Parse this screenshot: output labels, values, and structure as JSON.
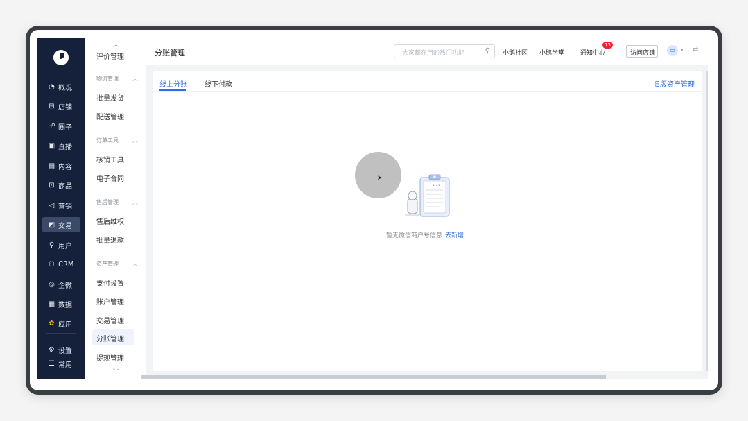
{
  "nav": {
    "items": [
      {
        "icon": "chart-pie-icon",
        "glyph": "◔",
        "label": "概况"
      },
      {
        "icon": "store-icon",
        "glyph": "⊟",
        "label": "店铺"
      },
      {
        "icon": "community-icon",
        "glyph": "☍",
        "label": "圈子"
      },
      {
        "icon": "live-icon",
        "glyph": "▣",
        "label": "直播"
      },
      {
        "icon": "content-icon",
        "glyph": "▤",
        "label": "内容"
      },
      {
        "icon": "goods-icon",
        "glyph": "⊡",
        "label": "商品"
      },
      {
        "icon": "marketing-icon",
        "glyph": "◁",
        "label": "营销"
      },
      {
        "icon": "trade-icon",
        "glyph": "◩",
        "label": "交易"
      },
      {
        "icon": "user-icon",
        "glyph": "⚲",
        "label": "用户"
      },
      {
        "icon": "crm-icon",
        "glyph": "⚇",
        "label": "CRM"
      },
      {
        "icon": "wecom-icon",
        "glyph": "◎",
        "label": "企微"
      },
      {
        "icon": "data-icon",
        "glyph": "▦",
        "label": "数据"
      },
      {
        "icon": "apps-icon",
        "glyph": "✿",
        "label": "应用"
      },
      {
        "icon": "settings-icon",
        "glyph": "⚙",
        "label": "设置"
      },
      {
        "icon": "common-icon",
        "glyph": "☰",
        "label": "常用"
      }
    ]
  },
  "submenu": {
    "top_item": "评价管理",
    "groups": [
      {
        "title": "物流管理",
        "items": [
          "批量发货",
          "配送管理"
        ]
      },
      {
        "title": "订单工具",
        "items": [
          "核销工具",
          "电子合同"
        ]
      },
      {
        "title": "售后管理",
        "items": [
          "售后维权",
          "批量退款"
        ]
      },
      {
        "title": "资产管理",
        "items": [
          "支付设置",
          "账户管理",
          "交易管理",
          "分账管理",
          "提现管理"
        ]
      }
    ]
  },
  "header": {
    "title": "分账管理",
    "search_placeholder": "大家都在用的热门功能",
    "links": [
      "小鹅社区",
      "小鹅学堂",
      "通知中心"
    ],
    "notice_badge": "13",
    "visit_store": "访问店铺"
  },
  "tabs": [
    "线上分账",
    "线下付款"
  ],
  "old_link": "旧版资产管理",
  "empty": {
    "text": "暂无微信商户号信息",
    "link": "去新增"
  },
  "colors": {
    "nav_bg": "#15213b",
    "accent": "#2f6fe4",
    "badge": "#f5222d"
  }
}
